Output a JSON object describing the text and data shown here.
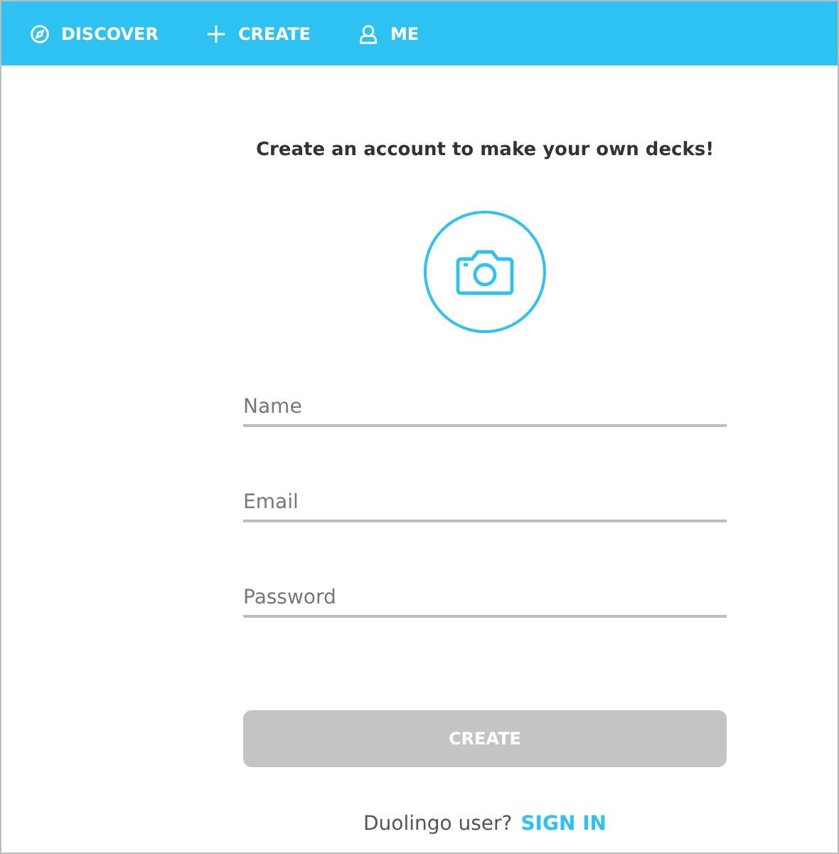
{
  "nav": [
    {
      "kind": "compass",
      "label": "DISCOVER"
    },
    {
      "kind": "plus",
      "label": "CREATE"
    },
    {
      "kind": "person",
      "label": "ME"
    }
  ],
  "heading": "Create an account to make your own decks!",
  "fields": [
    {
      "placeholder": "Name"
    },
    {
      "placeholder": "Email"
    },
    {
      "placeholder": "Password"
    }
  ],
  "submit": {
    "label": "CREATE",
    "disabled": true
  },
  "footer": {
    "text": "Duolingo user?",
    "link": "SIGN IN"
  }
}
